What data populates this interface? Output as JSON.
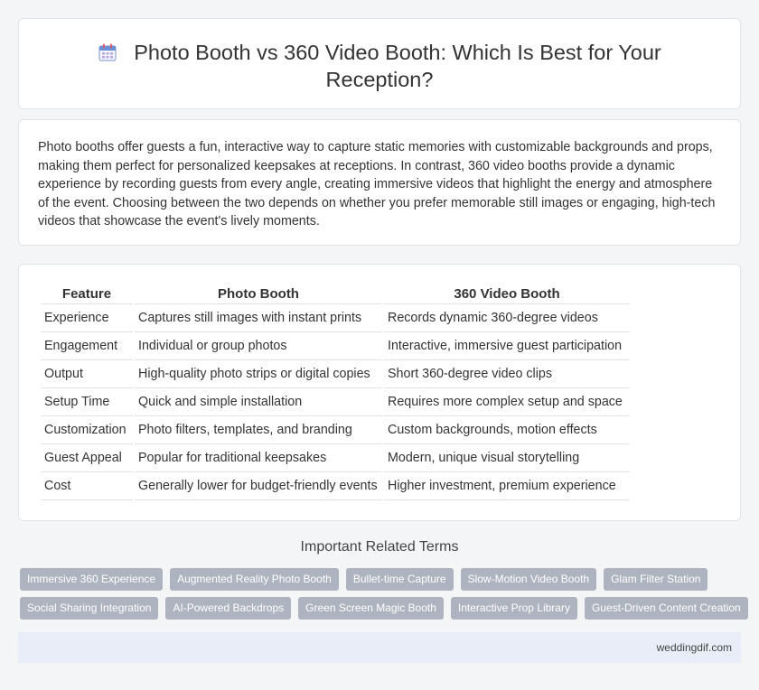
{
  "header": {
    "title": "Photo Booth vs 360 Video Booth: Which Is Best for Your Reception?",
    "icon": "calendar-icon"
  },
  "intro": {
    "text": "Photo booths offer guests a fun, interactive way to capture static memories with customizable backgrounds and props, making them perfect for personalized keepsakes at receptions. In contrast, 360 video booths provide a dynamic experience by recording guests from every angle, creating immersive videos that highlight the energy and atmosphere of the event. Choosing between the two depends on whether you prefer memorable still images or engaging, high-tech videos that showcase the event's lively moments."
  },
  "table": {
    "headers": [
      "Feature",
      "Photo Booth",
      "360 Video Booth"
    ],
    "rows": [
      [
        "Experience",
        "Captures still images with instant prints",
        "Records dynamic 360-degree videos"
      ],
      [
        "Engagement",
        "Individual or group photos",
        "Interactive, immersive guest participation"
      ],
      [
        "Output",
        "High-quality photo strips or digital copies",
        "Short 360-degree video clips"
      ],
      [
        "Setup Time",
        "Quick and simple installation",
        "Requires more complex setup and space"
      ],
      [
        "Customization",
        "Photo filters, templates, and branding",
        "Custom backgrounds, motion effects"
      ],
      [
        "Guest Appeal",
        "Popular for traditional keepsakes",
        "Modern, unique visual storytelling"
      ],
      [
        "Cost",
        "Generally lower for budget-friendly events",
        "Higher investment, premium experience"
      ]
    ]
  },
  "related": {
    "heading": "Important Related Terms",
    "row1": [
      "Immersive 360 Experience",
      "Augmented Reality Photo Booth",
      "Bullet-time Capture",
      "Slow-Motion Video Booth",
      "Glam Filter Station"
    ],
    "row2": [
      "Social Sharing Integration",
      "AI-Powered Backdrops",
      "Green Screen Magic Booth",
      "Interactive Prop Library",
      "Guest-Driven Content Creation"
    ]
  },
  "footer": {
    "site": "weddingdif.com"
  },
  "colors": {
    "chip_bg": "#aeb4bf",
    "footer_bg": "#e9edf7",
    "icon_accent": "#6b8fd6"
  }
}
